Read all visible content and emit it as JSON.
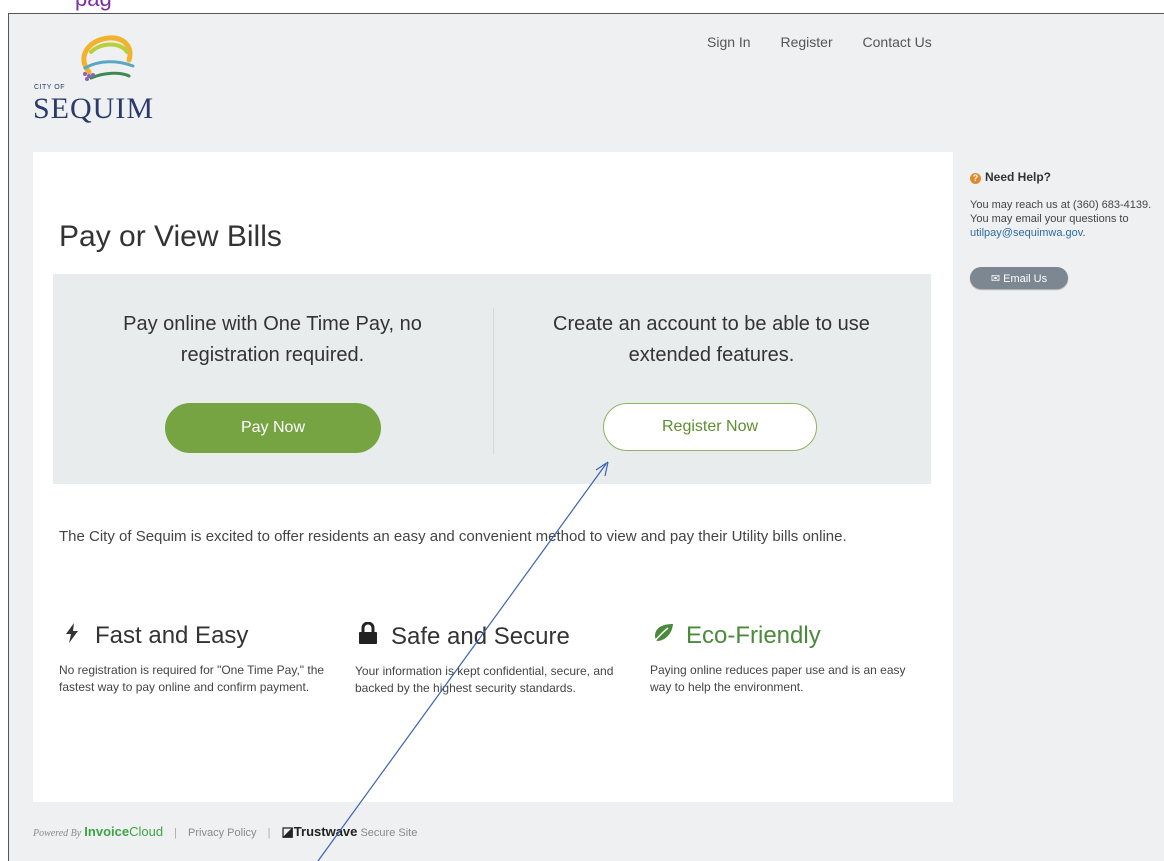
{
  "top_fragment": "pag",
  "logo": {
    "city_of": "CITY OF",
    "name": "SEQUIM"
  },
  "nav": {
    "sign_in": "Sign In",
    "register": "Register",
    "contact": "Contact Us"
  },
  "page_title": "Pay or View Bills",
  "options": {
    "one_time": {
      "text": "Pay online with One Time Pay, no registration required.",
      "button": "Pay Now"
    },
    "account": {
      "text": "Create an account to be able to use extended features.",
      "button": "Register Now"
    }
  },
  "intro": "The City of Sequim is excited to offer residents an easy and convenient method to view and pay their Utility bills online.",
  "features": [
    {
      "icon": "bolt-icon",
      "title": "Fast and Easy",
      "text": "No registration is required for \"One Time Pay,\" the fastest way to pay online and confirm payment."
    },
    {
      "icon": "lock-icon",
      "title": "Safe and Secure",
      "text": "Your information is kept confidential, secure, and backed by the highest security standards."
    },
    {
      "icon": "leaf-icon",
      "title": "Eco-Friendly",
      "text": "Paying online reduces paper use and is an easy way to help the environment."
    }
  ],
  "footer": {
    "powered_by": "Powered By",
    "brand_bold": "Invoice",
    "brand_light": "Cloud",
    "privacy": "Privacy Policy",
    "trustwave": "Trustwave",
    "secure_site": "Secure Site"
  },
  "help": {
    "title": "Need Help?",
    "phone_line": "You may reach us at (360) 683-4139.",
    "email_line": "You may email your questions to",
    "email": "utilpay@sequimwa.gov",
    "button": "Email Us"
  },
  "colors": {
    "green": "#76a443",
    "eco_green": "#4a8a3c",
    "link": "#2d6da3",
    "annotation_arrow": "#3a62b0"
  }
}
